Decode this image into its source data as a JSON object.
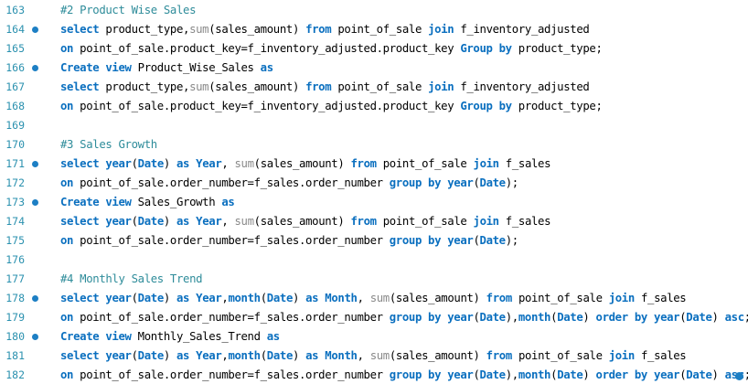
{
  "colors": {
    "line_number": "#2b91af",
    "keyword": "#0a6fbf",
    "function": "#8a8a8a",
    "comment": "#2e8c9a",
    "text": "#000000",
    "marker": "#1d7fc4"
  },
  "editor": {
    "lines": [
      {
        "num": "163",
        "marker": false,
        "tokens": [
          {
            "t": "cm",
            "v": "#2 Product Wise Sales"
          }
        ]
      },
      {
        "num": "164",
        "marker": true,
        "tokens": [
          {
            "t": "kw",
            "v": "select"
          },
          {
            "t": "tx",
            "v": " product_type,"
          },
          {
            "t": "fn",
            "v": "sum"
          },
          {
            "t": "tx",
            "v": "(sales_amount) "
          },
          {
            "t": "kw",
            "v": "from"
          },
          {
            "t": "tx",
            "v": " point_of_sale "
          },
          {
            "t": "kw",
            "v": "join"
          },
          {
            "t": "tx",
            "v": " f_inventory_adjusted"
          }
        ]
      },
      {
        "num": "165",
        "marker": false,
        "tokens": [
          {
            "t": "kw",
            "v": "on"
          },
          {
            "t": "tx",
            "v": " point_of_sale.product_key=f_inventory_adjusted.product_key "
          },
          {
            "t": "kw",
            "v": "Group by"
          },
          {
            "t": "tx",
            "v": " product_type;"
          }
        ]
      },
      {
        "num": "166",
        "marker": true,
        "tokens": [
          {
            "t": "kw",
            "v": "Create view"
          },
          {
            "t": "tx",
            "v": " Product_Wise_Sales "
          },
          {
            "t": "kw",
            "v": "as"
          }
        ]
      },
      {
        "num": "167",
        "marker": false,
        "tokens": [
          {
            "t": "kw",
            "v": "select"
          },
          {
            "t": "tx",
            "v": " product_type,"
          },
          {
            "t": "fn",
            "v": "sum"
          },
          {
            "t": "tx",
            "v": "(sales_amount) "
          },
          {
            "t": "kw",
            "v": "from"
          },
          {
            "t": "tx",
            "v": " point_of_sale "
          },
          {
            "t": "kw",
            "v": "join"
          },
          {
            "t": "tx",
            "v": " f_inventory_adjusted"
          }
        ]
      },
      {
        "num": "168",
        "marker": false,
        "tokens": [
          {
            "t": "kw",
            "v": "on"
          },
          {
            "t": "tx",
            "v": " point_of_sale.product_key=f_inventory_adjusted.product_key "
          },
          {
            "t": "kw",
            "v": "Group by"
          },
          {
            "t": "tx",
            "v": " product_type;"
          }
        ]
      },
      {
        "num": "169",
        "marker": false,
        "tokens": []
      },
      {
        "num": "170",
        "marker": false,
        "tokens": [
          {
            "t": "cm",
            "v": "#3 Sales Growth"
          }
        ]
      },
      {
        "num": "171",
        "marker": true,
        "tokens": [
          {
            "t": "kw",
            "v": "select"
          },
          {
            "t": "tx",
            "v": " "
          },
          {
            "t": "kw",
            "v": "year"
          },
          {
            "t": "tx",
            "v": "("
          },
          {
            "t": "kw",
            "v": "Date"
          },
          {
            "t": "tx",
            "v": ") "
          },
          {
            "t": "kw",
            "v": "as"
          },
          {
            "t": "tx",
            "v": " "
          },
          {
            "t": "kw",
            "v": "Year"
          },
          {
            "t": "tx",
            "v": ", "
          },
          {
            "t": "fn",
            "v": "sum"
          },
          {
            "t": "tx",
            "v": "(sales_amount) "
          },
          {
            "t": "kw",
            "v": "from"
          },
          {
            "t": "tx",
            "v": " point_of_sale "
          },
          {
            "t": "kw",
            "v": "join"
          },
          {
            "t": "tx",
            "v": " f_sales"
          }
        ]
      },
      {
        "num": "172",
        "marker": false,
        "tokens": [
          {
            "t": "kw",
            "v": "on"
          },
          {
            "t": "tx",
            "v": " point_of_sale.order_number=f_sales.order_number "
          },
          {
            "t": "kw",
            "v": "group by"
          },
          {
            "t": "tx",
            "v": " "
          },
          {
            "t": "kw",
            "v": "year"
          },
          {
            "t": "tx",
            "v": "("
          },
          {
            "t": "kw",
            "v": "Date"
          },
          {
            "t": "tx",
            "v": ");"
          }
        ]
      },
      {
        "num": "173",
        "marker": true,
        "tokens": [
          {
            "t": "kw",
            "v": "Create view"
          },
          {
            "t": "tx",
            "v": " Sales_Growth "
          },
          {
            "t": "kw",
            "v": "as"
          }
        ]
      },
      {
        "num": "174",
        "marker": false,
        "tokens": [
          {
            "t": "kw",
            "v": "select"
          },
          {
            "t": "tx",
            "v": " "
          },
          {
            "t": "kw",
            "v": "year"
          },
          {
            "t": "tx",
            "v": "("
          },
          {
            "t": "kw",
            "v": "Date"
          },
          {
            "t": "tx",
            "v": ") "
          },
          {
            "t": "kw",
            "v": "as"
          },
          {
            "t": "tx",
            "v": " "
          },
          {
            "t": "kw",
            "v": "Year"
          },
          {
            "t": "tx",
            "v": ", "
          },
          {
            "t": "fn",
            "v": "sum"
          },
          {
            "t": "tx",
            "v": "(sales_amount) "
          },
          {
            "t": "kw",
            "v": "from"
          },
          {
            "t": "tx",
            "v": " point_of_sale "
          },
          {
            "t": "kw",
            "v": "join"
          },
          {
            "t": "tx",
            "v": " f_sales"
          }
        ]
      },
      {
        "num": "175",
        "marker": false,
        "tokens": [
          {
            "t": "kw",
            "v": "on"
          },
          {
            "t": "tx",
            "v": " point_of_sale.order_number=f_sales.order_number "
          },
          {
            "t": "kw",
            "v": "group by"
          },
          {
            "t": "tx",
            "v": " "
          },
          {
            "t": "kw",
            "v": "year"
          },
          {
            "t": "tx",
            "v": "("
          },
          {
            "t": "kw",
            "v": "Date"
          },
          {
            "t": "tx",
            "v": ");"
          }
        ]
      },
      {
        "num": "176",
        "marker": false,
        "tokens": []
      },
      {
        "num": "177",
        "marker": false,
        "tokens": [
          {
            "t": "cm",
            "v": "#4 Monthly Sales Trend"
          }
        ]
      },
      {
        "num": "178",
        "marker": true,
        "tokens": [
          {
            "t": "kw",
            "v": "select"
          },
          {
            "t": "tx",
            "v": " "
          },
          {
            "t": "kw",
            "v": "year"
          },
          {
            "t": "tx",
            "v": "("
          },
          {
            "t": "kw",
            "v": "Date"
          },
          {
            "t": "tx",
            "v": ") "
          },
          {
            "t": "kw",
            "v": "as"
          },
          {
            "t": "tx",
            "v": " "
          },
          {
            "t": "kw",
            "v": "Year"
          },
          {
            "t": "tx",
            "v": ","
          },
          {
            "t": "kw",
            "v": "month"
          },
          {
            "t": "tx",
            "v": "("
          },
          {
            "t": "kw",
            "v": "Date"
          },
          {
            "t": "tx",
            "v": ") "
          },
          {
            "t": "kw",
            "v": "as"
          },
          {
            "t": "tx",
            "v": " "
          },
          {
            "t": "kw",
            "v": "Month"
          },
          {
            "t": "tx",
            "v": ", "
          },
          {
            "t": "fn",
            "v": "sum"
          },
          {
            "t": "tx",
            "v": "(sales_amount) "
          },
          {
            "t": "kw",
            "v": "from"
          },
          {
            "t": "tx",
            "v": " point_of_sale "
          },
          {
            "t": "kw",
            "v": "join"
          },
          {
            "t": "tx",
            "v": " f_sales"
          }
        ]
      },
      {
        "num": "179",
        "marker": false,
        "tokens": [
          {
            "t": "kw",
            "v": "on"
          },
          {
            "t": "tx",
            "v": " point_of_sale.order_number=f_sales.order_number "
          },
          {
            "t": "kw",
            "v": "group by"
          },
          {
            "t": "tx",
            "v": " "
          },
          {
            "t": "kw",
            "v": "year"
          },
          {
            "t": "tx",
            "v": "("
          },
          {
            "t": "kw",
            "v": "Date"
          },
          {
            "t": "tx",
            "v": "),"
          },
          {
            "t": "kw",
            "v": "month"
          },
          {
            "t": "tx",
            "v": "("
          },
          {
            "t": "kw",
            "v": "Date"
          },
          {
            "t": "tx",
            "v": ") "
          },
          {
            "t": "kw",
            "v": "order by"
          },
          {
            "t": "tx",
            "v": " "
          },
          {
            "t": "kw",
            "v": "year"
          },
          {
            "t": "tx",
            "v": "("
          },
          {
            "t": "kw",
            "v": "Date"
          },
          {
            "t": "tx",
            "v": ") "
          },
          {
            "t": "kw",
            "v": "asc"
          },
          {
            "t": "tx",
            "v": ";"
          }
        ]
      },
      {
        "num": "180",
        "marker": true,
        "tokens": [
          {
            "t": "kw",
            "v": "Create view"
          },
          {
            "t": "tx",
            "v": " Monthly_Sales_Trend "
          },
          {
            "t": "kw",
            "v": "as"
          }
        ]
      },
      {
        "num": "181",
        "marker": false,
        "tokens": [
          {
            "t": "kw",
            "v": "select"
          },
          {
            "t": "tx",
            "v": " "
          },
          {
            "t": "kw",
            "v": "year"
          },
          {
            "t": "tx",
            "v": "("
          },
          {
            "t": "kw",
            "v": "Date"
          },
          {
            "t": "tx",
            "v": ") "
          },
          {
            "t": "kw",
            "v": "as"
          },
          {
            "t": "tx",
            "v": " "
          },
          {
            "t": "kw",
            "v": "Year"
          },
          {
            "t": "tx",
            "v": ","
          },
          {
            "t": "kw",
            "v": "month"
          },
          {
            "t": "tx",
            "v": "("
          },
          {
            "t": "kw",
            "v": "Date"
          },
          {
            "t": "tx",
            "v": ") "
          },
          {
            "t": "kw",
            "v": "as"
          },
          {
            "t": "tx",
            "v": " "
          },
          {
            "t": "kw",
            "v": "Month"
          },
          {
            "t": "tx",
            "v": ", "
          },
          {
            "t": "fn",
            "v": "sum"
          },
          {
            "t": "tx",
            "v": "(sales_amount) "
          },
          {
            "t": "kw",
            "v": "from"
          },
          {
            "t": "tx",
            "v": " point_of_sale "
          },
          {
            "t": "kw",
            "v": "join"
          },
          {
            "t": "tx",
            "v": " f_sales"
          }
        ]
      },
      {
        "num": "182",
        "marker": false,
        "tokens": [
          {
            "t": "kw",
            "v": "on"
          },
          {
            "t": "tx",
            "v": " point_of_sale.order_number=f_sales.order_number "
          },
          {
            "t": "kw",
            "v": "group by"
          },
          {
            "t": "tx",
            "v": " "
          },
          {
            "t": "kw",
            "v": "year"
          },
          {
            "t": "tx",
            "v": "("
          },
          {
            "t": "kw",
            "v": "Date"
          },
          {
            "t": "tx",
            "v": "),"
          },
          {
            "t": "kw",
            "v": "month"
          },
          {
            "t": "tx",
            "v": "("
          },
          {
            "t": "kw",
            "v": "Date"
          },
          {
            "t": "tx",
            "v": ") "
          },
          {
            "t": "kw",
            "v": "order by"
          },
          {
            "t": "tx",
            "v": " "
          },
          {
            "t": "kw",
            "v": "year"
          },
          {
            "t": "tx",
            "v": "("
          },
          {
            "t": "kw",
            "v": "Date"
          },
          {
            "t": "tx",
            "v": ") "
          },
          {
            "t": "kw",
            "v": "asc"
          },
          {
            "t": "tx",
            "v": ";"
          }
        ]
      }
    ]
  }
}
